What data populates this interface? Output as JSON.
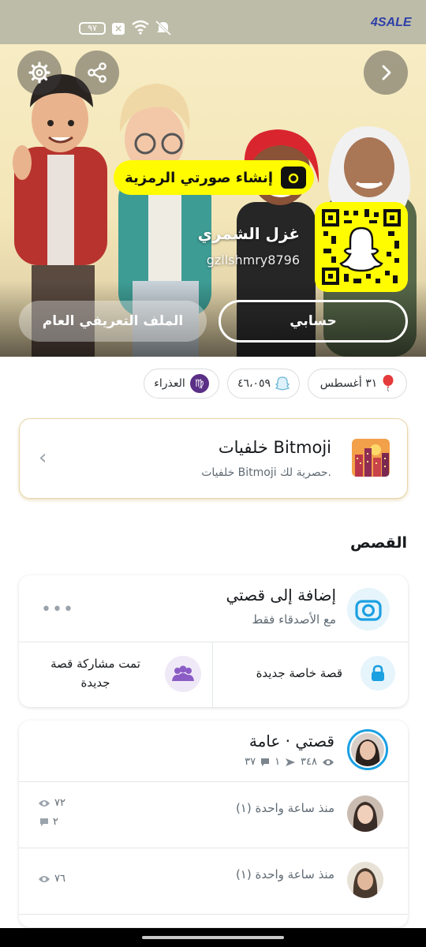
{
  "status_bar": {
    "battery": "٩٧",
    "brand_logo": "4SALE",
    "icons": [
      "close-box-icon",
      "wifi-icon",
      "mute-icon",
      "battery-icon"
    ]
  },
  "profile": {
    "display_name": "غزل الشمري",
    "username": "gzllshmry8796",
    "create_bitmoji_label": "إنشاء صورتي الرمزية",
    "public_profile_label": "الملف التعريفي العام",
    "account_label": "حسابي"
  },
  "badges": {
    "birthday": "٣١ أغسطس",
    "score": "٤٦،٠٥٩",
    "zodiac": "العذراء",
    "zodiac_symbol": "♍"
  },
  "bitmoji_card": {
    "title": "خلفيات Bitmoji",
    "subtitle": "خلفيات Bitmoji حصرية لك."
  },
  "stories_section": {
    "title": "القصص",
    "add_title": "إضافة إلى قصتي",
    "add_subtitle": "مع الأصدقاء فقط",
    "new_private_story": "قصة خاصة جديدة",
    "new_shared_story": "تمت مشاركة قصة جديدة"
  },
  "my_story": {
    "title": "قصتي · عامة",
    "views": "٣٤٨",
    "shares": "١",
    "replies": "٣٧",
    "rows": [
      {
        "time": "منذ ساعة واحدة (١)",
        "views": "٧٢",
        "replies": "٢"
      },
      {
        "time": "منذ ساعة واحدة (١)",
        "views": "٧٦",
        "replies": ""
      }
    ]
  },
  "colors": {
    "snap_yellow": "#FFFC00",
    "accent_blue": "#1BA0E2",
    "purple": "#8B5CC5"
  }
}
